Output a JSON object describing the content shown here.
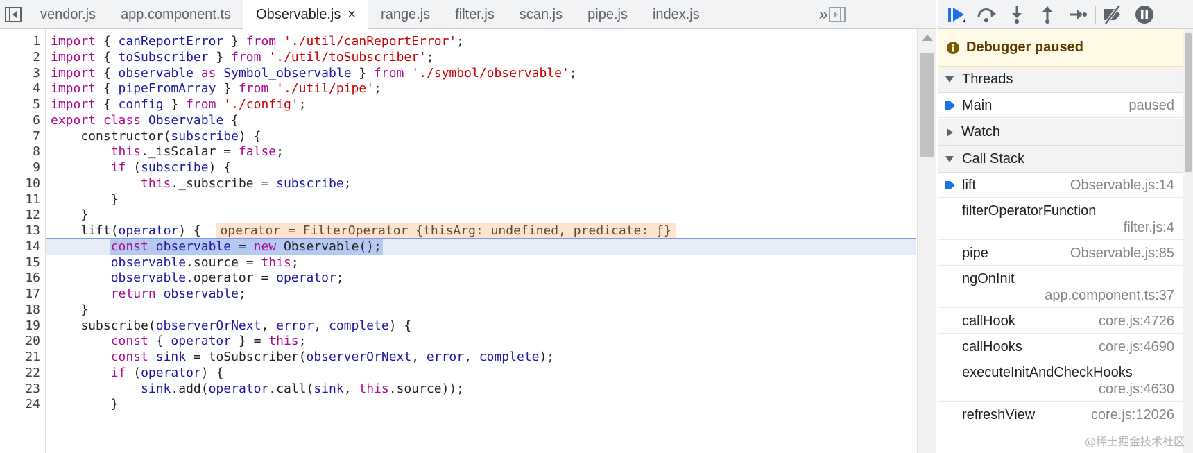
{
  "tabs": [
    {
      "label": "vendor.js",
      "active": false
    },
    {
      "label": "app.component.ts",
      "active": false
    },
    {
      "label": "Observable.js",
      "active": true
    },
    {
      "label": "range.js",
      "active": false
    },
    {
      "label": "filter.js",
      "active": false
    },
    {
      "label": "scan.js",
      "active": false
    },
    {
      "label": "pipe.js",
      "active": false
    },
    {
      "label": "index.js",
      "active": false
    }
  ],
  "more_tabs_glyph": "»",
  "tab_close_glyph": "×",
  "code_lines": [
    {
      "n": "1",
      "tokens": [
        [
          "kw",
          "import"
        ],
        [
          "pl",
          " { "
        ],
        [
          "id",
          "canReportError"
        ],
        [
          "pl",
          " } "
        ],
        [
          "kw",
          "from"
        ],
        [
          "pl",
          " "
        ],
        [
          "str",
          "'./util/canReportError'"
        ],
        [
          "pl",
          ";"
        ]
      ]
    },
    {
      "n": "2",
      "tokens": [
        [
          "kw",
          "import"
        ],
        [
          "pl",
          " { "
        ],
        [
          "id",
          "toSubscriber"
        ],
        [
          "pl",
          " } "
        ],
        [
          "kw",
          "from"
        ],
        [
          "pl",
          " "
        ],
        [
          "str",
          "'./util/toSubscriber'"
        ],
        [
          "pl",
          ";"
        ]
      ]
    },
    {
      "n": "3",
      "tokens": [
        [
          "kw",
          "import"
        ],
        [
          "pl",
          " { "
        ],
        [
          "id",
          "observable"
        ],
        [
          "pl",
          " "
        ],
        [
          "kw",
          "as"
        ],
        [
          "pl",
          " "
        ],
        [
          "id",
          "Symbol_observable"
        ],
        [
          "pl",
          " } "
        ],
        [
          "kw",
          "from"
        ],
        [
          "pl",
          " "
        ],
        [
          "str",
          "'./symbol/observable'"
        ],
        [
          "pl",
          ";"
        ]
      ]
    },
    {
      "n": "4",
      "tokens": [
        [
          "kw",
          "import"
        ],
        [
          "pl",
          " { "
        ],
        [
          "id",
          "pipeFromArray"
        ],
        [
          "pl",
          " } "
        ],
        [
          "kw",
          "from"
        ],
        [
          "pl",
          " "
        ],
        [
          "str",
          "'./util/pipe'"
        ],
        [
          "pl",
          ";"
        ]
      ]
    },
    {
      "n": "5",
      "tokens": [
        [
          "kw",
          "import"
        ],
        [
          "pl",
          " { "
        ],
        [
          "id",
          "config"
        ],
        [
          "pl",
          " } "
        ],
        [
          "kw",
          "from"
        ],
        [
          "pl",
          " "
        ],
        [
          "str",
          "'./config'"
        ],
        [
          "pl",
          ";"
        ]
      ]
    },
    {
      "n": "6",
      "tokens": [
        [
          "kw",
          "export"
        ],
        [
          "pl",
          " "
        ],
        [
          "kw",
          "class"
        ],
        [
          "pl",
          " "
        ],
        [
          "id",
          "Observable"
        ],
        [
          "pl",
          " {"
        ]
      ]
    },
    {
      "n": "7",
      "tokens": [
        [
          "pl",
          "    constructor("
        ],
        [
          "id",
          "subscribe"
        ],
        [
          "pl",
          ") {"
        ]
      ]
    },
    {
      "n": "8",
      "tokens": [
        [
          "pl",
          "        "
        ],
        [
          "kw",
          "this"
        ],
        [
          "pl",
          "._isScalar = "
        ],
        [
          "kw",
          "false"
        ],
        [
          "pl",
          ";"
        ]
      ]
    },
    {
      "n": "9",
      "tokens": [
        [
          "pl",
          "        "
        ],
        [
          "kw",
          "if"
        ],
        [
          "pl",
          " ("
        ],
        [
          "id",
          "subscribe"
        ],
        [
          "pl",
          ") {"
        ]
      ]
    },
    {
      "n": "10",
      "tokens": [
        [
          "pl",
          "            "
        ],
        [
          "kw",
          "this"
        ],
        [
          "pl",
          "._subscribe = "
        ],
        [
          "id",
          "subscribe"
        ],
        [
          "pl",
          ";"
        ]
      ]
    },
    {
      "n": "11",
      "tokens": [
        [
          "pl",
          "        }"
        ]
      ]
    },
    {
      "n": "12",
      "tokens": [
        [
          "pl",
          "    }"
        ]
      ]
    },
    {
      "n": "13",
      "tokens": [
        [
          "pl",
          "    lift("
        ],
        [
          "id",
          "operator"
        ],
        [
          "pl",
          ") {  "
        ]
      ],
      "inline_value": "operator = FilterOperator {thisArg: undefined, predicate: ƒ}"
    },
    {
      "n": "14",
      "exec": true,
      "tokens": [
        [
          "pl",
          "        "
        ],
        [
          "kw",
          "const"
        ],
        [
          "pl",
          " "
        ],
        [
          "id",
          "observable"
        ],
        [
          "pl",
          " = "
        ],
        [
          "kw",
          "new"
        ],
        [
          "pl",
          " Observable();"
        ]
      ]
    },
    {
      "n": "15",
      "tokens": [
        [
          "pl",
          "        "
        ],
        [
          "id",
          "observable"
        ],
        [
          "pl",
          ".source = "
        ],
        [
          "kw",
          "this"
        ],
        [
          "pl",
          ";"
        ]
      ]
    },
    {
      "n": "16",
      "tokens": [
        [
          "pl",
          "        "
        ],
        [
          "id",
          "observable"
        ],
        [
          "pl",
          ".operator = "
        ],
        [
          "id",
          "operator"
        ],
        [
          "pl",
          ";"
        ]
      ]
    },
    {
      "n": "17",
      "tokens": [
        [
          "pl",
          "        "
        ],
        [
          "kw",
          "return"
        ],
        [
          "pl",
          " "
        ],
        [
          "id",
          "observable"
        ],
        [
          "pl",
          ";"
        ]
      ]
    },
    {
      "n": "18",
      "tokens": [
        [
          "pl",
          "    }"
        ]
      ]
    },
    {
      "n": "19",
      "tokens": [
        [
          "pl",
          "    subscribe("
        ],
        [
          "id",
          "observerOrNext"
        ],
        [
          "pl",
          ", "
        ],
        [
          "id",
          "error"
        ],
        [
          "pl",
          ", "
        ],
        [
          "id",
          "complete"
        ],
        [
          "pl",
          ") {"
        ]
      ]
    },
    {
      "n": "20",
      "tokens": [
        [
          "pl",
          "        "
        ],
        [
          "kw",
          "const"
        ],
        [
          "pl",
          " { "
        ],
        [
          "id",
          "operator"
        ],
        [
          "pl",
          " } = "
        ],
        [
          "kw",
          "this"
        ],
        [
          "pl",
          ";"
        ]
      ]
    },
    {
      "n": "21",
      "tokens": [
        [
          "pl",
          "        "
        ],
        [
          "kw",
          "const"
        ],
        [
          "pl",
          " "
        ],
        [
          "id",
          "sink"
        ],
        [
          "pl",
          " = toSubscriber("
        ],
        [
          "id",
          "observerOrNext"
        ],
        [
          "pl",
          ", "
        ],
        [
          "id",
          "error"
        ],
        [
          "pl",
          ", "
        ],
        [
          "id",
          "complete"
        ],
        [
          "pl",
          ");"
        ]
      ]
    },
    {
      "n": "22",
      "tokens": [
        [
          "pl",
          "        "
        ],
        [
          "kw",
          "if"
        ],
        [
          "pl",
          " ("
        ],
        [
          "id",
          "operator"
        ],
        [
          "pl",
          ") {"
        ]
      ]
    },
    {
      "n": "23",
      "tokens": [
        [
          "pl",
          "            "
        ],
        [
          "id",
          "sink"
        ],
        [
          "pl",
          ".add("
        ],
        [
          "id",
          "operator"
        ],
        [
          "pl",
          ".call("
        ],
        [
          "id",
          "sink"
        ],
        [
          "pl",
          ", "
        ],
        [
          "kw",
          "this"
        ],
        [
          "pl",
          ".source));"
        ]
      ]
    },
    {
      "n": "24",
      "tokens": [
        [
          "pl",
          "        }"
        ]
      ]
    }
  ],
  "debugger": {
    "paused_text": "Debugger paused",
    "threads_label": "Threads",
    "thread": {
      "name": "Main",
      "status": "paused"
    },
    "watch_label": "Watch",
    "call_stack_label": "Call Stack",
    "call_stack": [
      {
        "fn": "lift",
        "loc": "Observable.js:14",
        "current": true,
        "wrap": false
      },
      {
        "fn": "filterOperatorFunction",
        "loc": "filter.js:4",
        "current": false,
        "wrap": true
      },
      {
        "fn": "pipe",
        "loc": "Observable.js:85",
        "current": false,
        "wrap": false
      },
      {
        "fn": "ngOnInit",
        "loc": "app.component.ts:37",
        "current": false,
        "wrap": true
      },
      {
        "fn": "callHook",
        "loc": "core.js:4726",
        "current": false,
        "wrap": false
      },
      {
        "fn": "callHooks",
        "loc": "core.js:4690",
        "current": false,
        "wrap": false
      },
      {
        "fn": "executeInitAndCheckHooks",
        "loc": "core.js:4630",
        "current": false,
        "wrap": true
      },
      {
        "fn": "refreshView",
        "loc": "core.js:12026",
        "current": false,
        "wrap": false
      }
    ]
  },
  "watermark": "@稀土掘金技术社区",
  "colors": {
    "keyword": "#aa0d91",
    "string": "#c80000",
    "identifier": "#1c1aa3",
    "exec_line_bg": "#e6ecf8",
    "inline_value_bg": "#fde4cf",
    "paused_banner_bg": "#fffbe6",
    "accent_blue": "#1a73e8"
  }
}
